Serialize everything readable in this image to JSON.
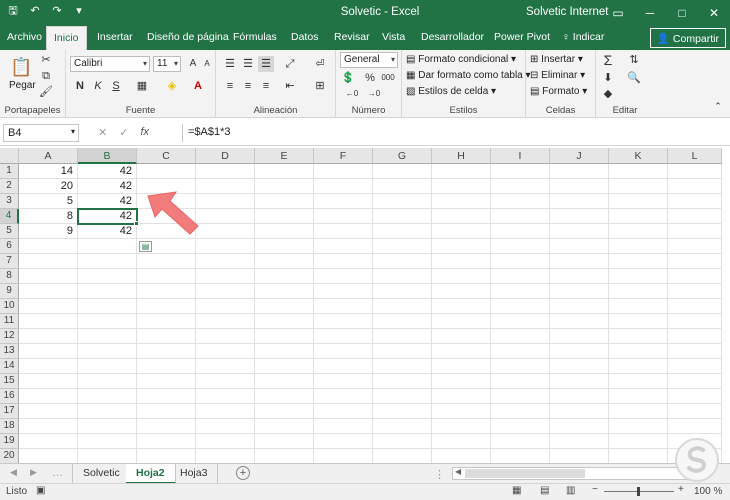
{
  "titlebar": {
    "title": "Solvetic  -  Excel",
    "user": "Solvetic Internet",
    "save_icon": "save-icon",
    "undo_icon": "undo-icon",
    "redo_icon": "redo-icon",
    "customize_icon": "customize-qat-icon"
  },
  "tabs": [
    "Archivo",
    "Inicio",
    "Insertar",
    "Diseño de página",
    "Fórmulas",
    "Datos",
    "Revisar",
    "Vista",
    "Desarrollador",
    "Power Pivot"
  ],
  "tellme": "Indicar",
  "share": "Compartir",
  "ribbon": {
    "clipboard": {
      "paste": "Pegar",
      "label": "Portapapeles"
    },
    "font": {
      "name": "Calibri",
      "size": "11",
      "label": "Fuente",
      "bold": "N",
      "italic": "K",
      "underline": "S"
    },
    "alignment": {
      "label": "Alineación"
    },
    "number": {
      "format": "General",
      "label": "Número",
      "percent": "%",
      "thousands": "000"
    },
    "styles": {
      "conditional": "Formato condicional",
      "table": "Dar formato como tabla",
      "cell": "Estilos de celda",
      "label": "Estilos"
    },
    "cells": {
      "insert": "Insertar",
      "delete": "Eliminar",
      "format": "Formato",
      "label": "Celdas"
    },
    "editing": {
      "label": "Editar"
    }
  },
  "formula_bar": {
    "name_box": "B4",
    "formula": "=$A$1*3"
  },
  "columns": [
    "A",
    "B",
    "C",
    "D",
    "E",
    "F",
    "G",
    "H",
    "I",
    "J",
    "K",
    "L"
  ],
  "rows": [
    "1",
    "2",
    "3",
    "4",
    "5",
    "6",
    "7",
    "8",
    "9",
    "10",
    "11",
    "12",
    "13",
    "14",
    "15",
    "16",
    "17",
    "18",
    "19",
    "20"
  ],
  "cells": {
    "A": [
      "14",
      "20",
      "5",
      "8",
      "9"
    ],
    "B": [
      "42",
      "42",
      "42",
      "42",
      "42"
    ]
  },
  "sheets": [
    "Solvetic",
    "Hoja2",
    "Hoja3"
  ],
  "active_sheet": "Hoja2",
  "status": {
    "ready": "Listo",
    "zoom": "100 %"
  },
  "colors": {
    "accent": "#217346",
    "arrow": "#f07a7a"
  }
}
